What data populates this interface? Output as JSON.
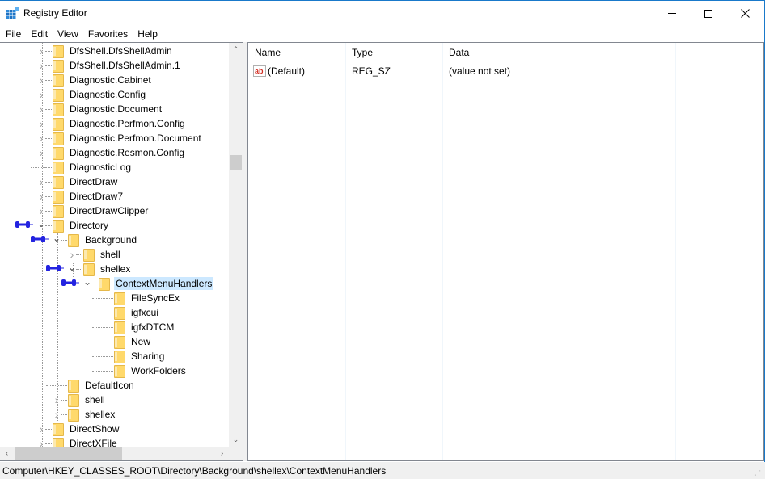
{
  "window": {
    "title": "Registry Editor",
    "minimize_label": "—",
    "maximize_label": "☐",
    "close_label": "✕"
  },
  "menu": [
    "File",
    "Edit",
    "View",
    "Favorites",
    "Help"
  ],
  "tree": {
    "items": [
      {
        "label": "DfsShell.DfsShellAdmin",
        "depth": 0,
        "expander": "collapsed"
      },
      {
        "label": "DfsShell.DfsShellAdmin.1",
        "depth": 0,
        "expander": "collapsed"
      },
      {
        "label": "Diagnostic.Cabinet",
        "depth": 0,
        "expander": "collapsed"
      },
      {
        "label": "Diagnostic.Config",
        "depth": 0,
        "expander": "collapsed"
      },
      {
        "label": "Diagnostic.Document",
        "depth": 0,
        "expander": "collapsed"
      },
      {
        "label": "Diagnostic.Perfmon.Config",
        "depth": 0,
        "expander": "collapsed"
      },
      {
        "label": "Diagnostic.Perfmon.Document",
        "depth": 0,
        "expander": "collapsed"
      },
      {
        "label": "Diagnostic.Resmon.Config",
        "depth": 0,
        "expander": "collapsed"
      },
      {
        "label": "DiagnosticLog",
        "depth": 0,
        "expander": "none"
      },
      {
        "label": "DirectDraw",
        "depth": 0,
        "expander": "collapsed"
      },
      {
        "label": "DirectDraw7",
        "depth": 0,
        "expander": "collapsed"
      },
      {
        "label": "DirectDrawClipper",
        "depth": 0,
        "expander": "collapsed"
      },
      {
        "label": "Directory",
        "depth": 0,
        "expander": "expanded",
        "pinned": true
      },
      {
        "label": "Background",
        "depth": 1,
        "expander": "expanded",
        "pinned": true
      },
      {
        "label": "shell",
        "depth": 2,
        "expander": "collapsed"
      },
      {
        "label": "shellex",
        "depth": 2,
        "expander": "expanded",
        "pinned": true
      },
      {
        "label": "ContextMenuHandlers",
        "depth": 3,
        "expander": "expanded",
        "pinned": true,
        "selected": true
      },
      {
        "label": "FileSyncEx",
        "depth": 4,
        "expander": "none"
      },
      {
        "label": "igfxcui",
        "depth": 4,
        "expander": "none"
      },
      {
        "label": "igfxDTCM",
        "depth": 4,
        "expander": "none"
      },
      {
        "label": "New",
        "depth": 4,
        "expander": "none"
      },
      {
        "label": "Sharing",
        "depth": 4,
        "expander": "none"
      },
      {
        "label": "WorkFolders",
        "depth": 4,
        "expander": "none"
      },
      {
        "label": "DefaultIcon",
        "depth": 1,
        "expander": "none"
      },
      {
        "label": "shell",
        "depth": 1,
        "expander": "collapsed"
      },
      {
        "label": "shellex",
        "depth": 1,
        "expander": "collapsed"
      },
      {
        "label": "DirectShow",
        "depth": 0,
        "expander": "collapsed"
      },
      {
        "label": "DirectXFile",
        "depth": 0,
        "expander": "collapsed"
      }
    ]
  },
  "list": {
    "columns": [
      "Name",
      "Type",
      "Data"
    ],
    "rows": [
      {
        "name": "(Default)",
        "type": "REG_SZ",
        "data": "(value not set)",
        "icon": "string-value-icon"
      }
    ]
  },
  "status": {
    "path": "Computer\\HKEY_CLASSES_ROOT\\Directory\\Background\\shellex\\ContextMenuHandlers"
  },
  "colors": {
    "selection": "#cce8ff",
    "window_border": "#1979ca",
    "pin_annotation": "#2323e0",
    "folder": "#ffd96b"
  }
}
